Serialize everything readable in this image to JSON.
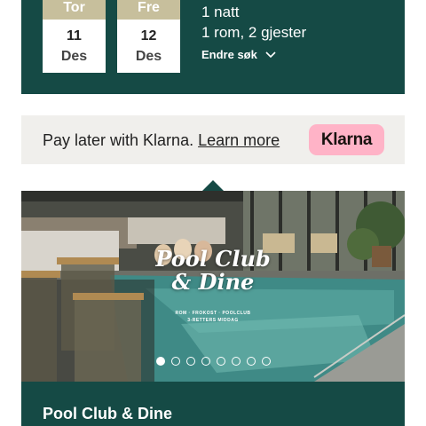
{
  "booking": {
    "checkin": {
      "dayname": "Tor",
      "day": "11",
      "month": "Des"
    },
    "checkout": {
      "dayname": "Fre",
      "day": "12",
      "month": "Des"
    },
    "nights": "1 natt",
    "rooms_guests": "1 rom, 2 gjester",
    "modify_label": "Endre søk"
  },
  "klarna": {
    "text": "Pay later with Klarna.",
    "link": "Learn more",
    "logo": "Klarna"
  },
  "offer": {
    "image_title_line1": "Pool Club",
    "image_title_line2": "& Dine",
    "image_subtitle_line1": "ROM · FROKOST · POOLCLUB",
    "image_subtitle_line2": "3-RETTERS MIDDAG",
    "name": "Pool Club & Dine",
    "slide_count": 8,
    "active_slide": 1
  },
  "colors": {
    "brand_green": "#154a45",
    "tan": "#c7bf9c",
    "klarna_pink": "#ffb3c7",
    "banner_bg": "#f0efec"
  }
}
